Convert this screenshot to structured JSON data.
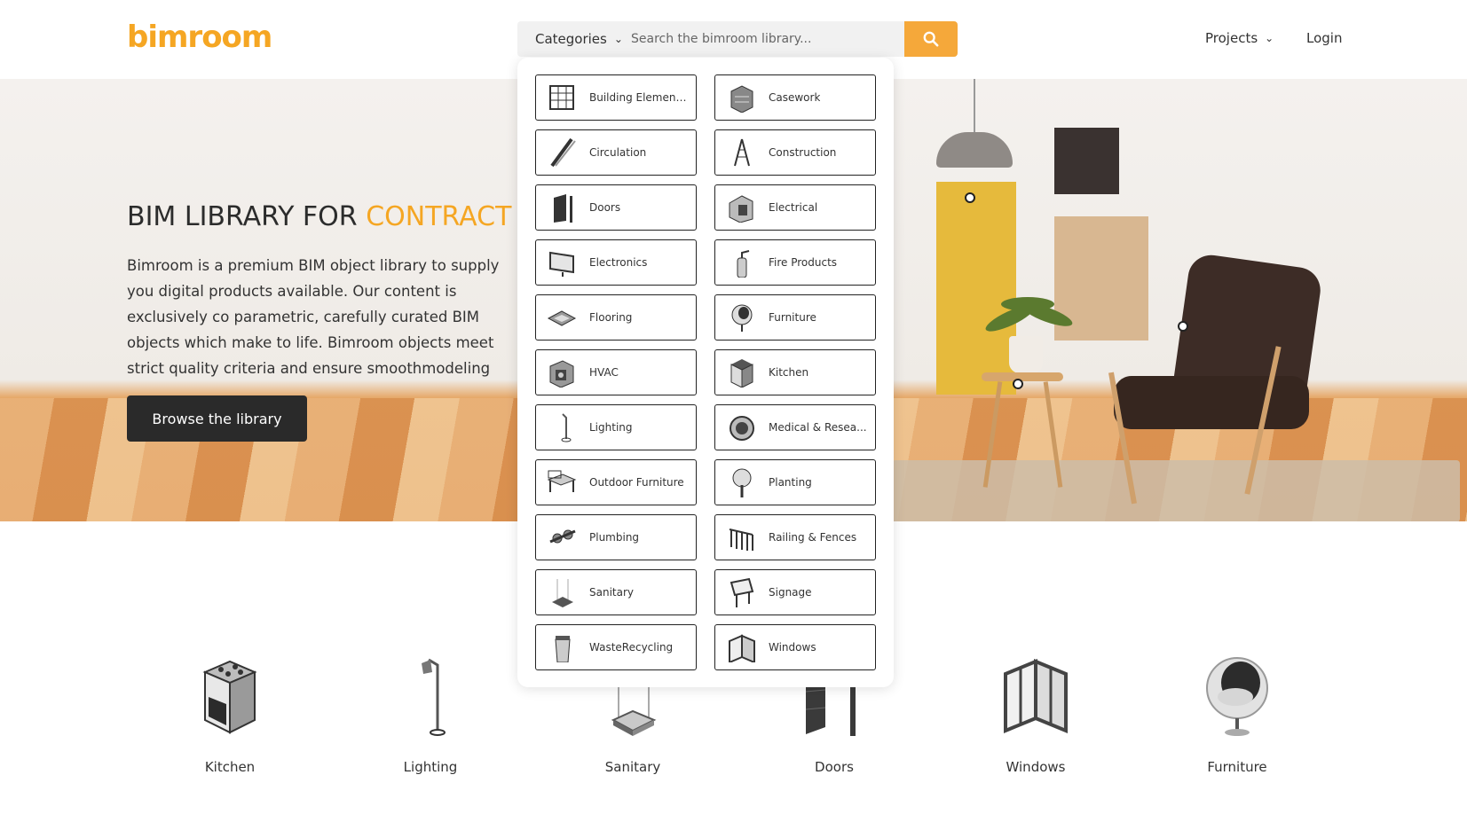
{
  "header": {
    "logo": "bimroom",
    "categories_label": "Categories",
    "search_placeholder": "Search the bimroom library...",
    "projects_label": "Projects",
    "login_label": "Login"
  },
  "hero": {
    "title_main": "BIM LIBRARY FOR ",
    "title_accent": "CONTRACT",
    "body": "Bimroom is a premium BIM object library to supply you digital products available. Our content is exclusively co parametric, carefully curated BIM objects which make to life. Bimroom objects meet strict quality criteria and ensure smoothmodeling across the entire lifecycle of y",
    "browse_label": "Browse the library"
  },
  "dropdown": {
    "items": [
      {
        "label": "Building Element...",
        "icon": "building-element-icon"
      },
      {
        "label": "Casework",
        "icon": "casework-icon"
      },
      {
        "label": "Circulation",
        "icon": "circulation-icon"
      },
      {
        "label": "Construction",
        "icon": "construction-icon"
      },
      {
        "label": "Doors",
        "icon": "doors-icon"
      },
      {
        "label": "Electrical",
        "icon": "electrical-icon"
      },
      {
        "label": "Electronics",
        "icon": "electronics-icon"
      },
      {
        "label": "Fire Products",
        "icon": "fire-products-icon"
      },
      {
        "label": "Flooring",
        "icon": "flooring-icon"
      },
      {
        "label": "Furniture",
        "icon": "furniture-icon"
      },
      {
        "label": "HVAC",
        "icon": "hvac-icon"
      },
      {
        "label": "Kitchen",
        "icon": "kitchen-icon"
      },
      {
        "label": "Lighting",
        "icon": "lighting-icon"
      },
      {
        "label": "Medical & Resea...",
        "icon": "medical-icon"
      },
      {
        "label": "Outdoor Furniture",
        "icon": "outdoor-furniture-icon"
      },
      {
        "label": "Planting",
        "icon": "planting-icon"
      },
      {
        "label": "Plumbing",
        "icon": "plumbing-icon"
      },
      {
        "label": "Railing & Fences",
        "icon": "railing-icon"
      },
      {
        "label": "Sanitary",
        "icon": "sanitary-icon"
      },
      {
        "label": "Signage",
        "icon": "signage-icon"
      },
      {
        "label": "WasteRecycling",
        "icon": "waste-recycling-icon"
      },
      {
        "label": "Windows",
        "icon": "windows-icon"
      }
    ]
  },
  "featured_categories": [
    {
      "label": "Kitchen",
      "icon": "kitchen-stove-icon"
    },
    {
      "label": "Lighting",
      "icon": "floor-lamp-icon"
    },
    {
      "label": "Sanitary",
      "icon": "shower-icon"
    },
    {
      "label": "Doors",
      "icon": "door-icon"
    },
    {
      "label": "Windows",
      "icon": "window-icon"
    },
    {
      "label": "Furniture",
      "icon": "egg-chair-icon"
    }
  ],
  "colors": {
    "accent": "#f5a623",
    "button_dark": "#2a2a2a",
    "search_button": "#f5a83a"
  }
}
